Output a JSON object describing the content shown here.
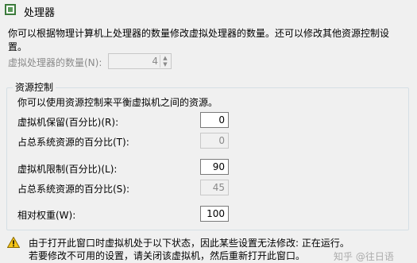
{
  "header": {
    "title": "处理器",
    "icon": "processor-icon"
  },
  "description": {
    "line1": "你可以根据物理计算机上处理器的数量修改虚拟处理器的数量。还可以修改其他资源控制设",
    "line2": "置。"
  },
  "virtual_processors": {
    "label": "虚拟处理器的数量(N):",
    "value": "4",
    "enabled": false
  },
  "resource_control": {
    "title": "资源控制",
    "description": "你可以使用资源控制来平衡虚拟机之间的资源。",
    "reserve": {
      "label": "虚拟机保留(百分比)(R):",
      "value": "0"
    },
    "reserve_total": {
      "label": "占总系统资源的百分比(T):",
      "value": "0"
    },
    "limit": {
      "label": "虚拟机限制(百分比)(L):",
      "value": "90"
    },
    "limit_total": {
      "label": "占总系统资源的百分比(S):",
      "value": "45"
    },
    "weight": {
      "label": "相对权重(W):",
      "value": "100"
    }
  },
  "footer": {
    "line1": "由于打开此窗口时虚拟机处于以下状态，因此某些设置无法修改: 正在运行。",
    "line2": "若要修改不可用的设置，请关闭该虚拟机，然后重新打开此窗口。",
    "watermark": "知乎 @往日语",
    "icon": "warning-icon"
  }
}
